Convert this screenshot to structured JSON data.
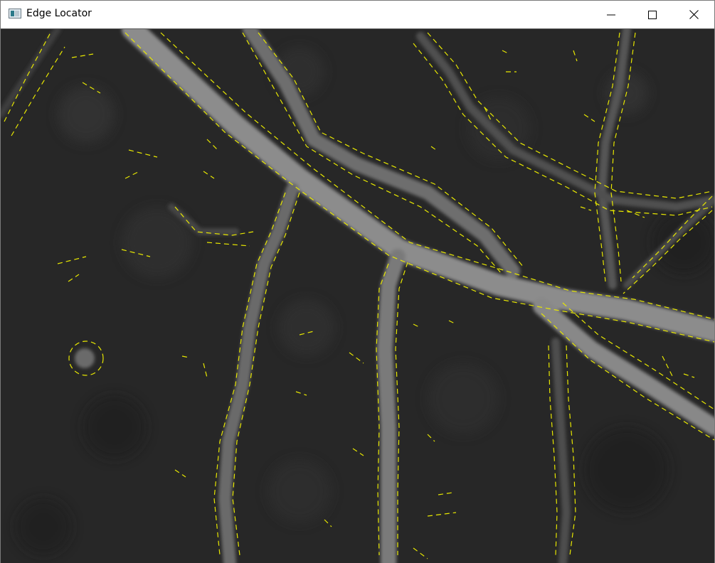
{
  "window": {
    "title": "Edge Locator",
    "icon": "app-window-icon"
  },
  "titlebar_buttons": {
    "minimize_icon": "minimize-icon",
    "maximize_icon": "maximize-icon",
    "close_icon": "close-icon"
  },
  "image_view": {
    "background_color": "#262626",
    "vessel_color": "#8a8a8a",
    "edge_color": "#e8e800"
  }
}
